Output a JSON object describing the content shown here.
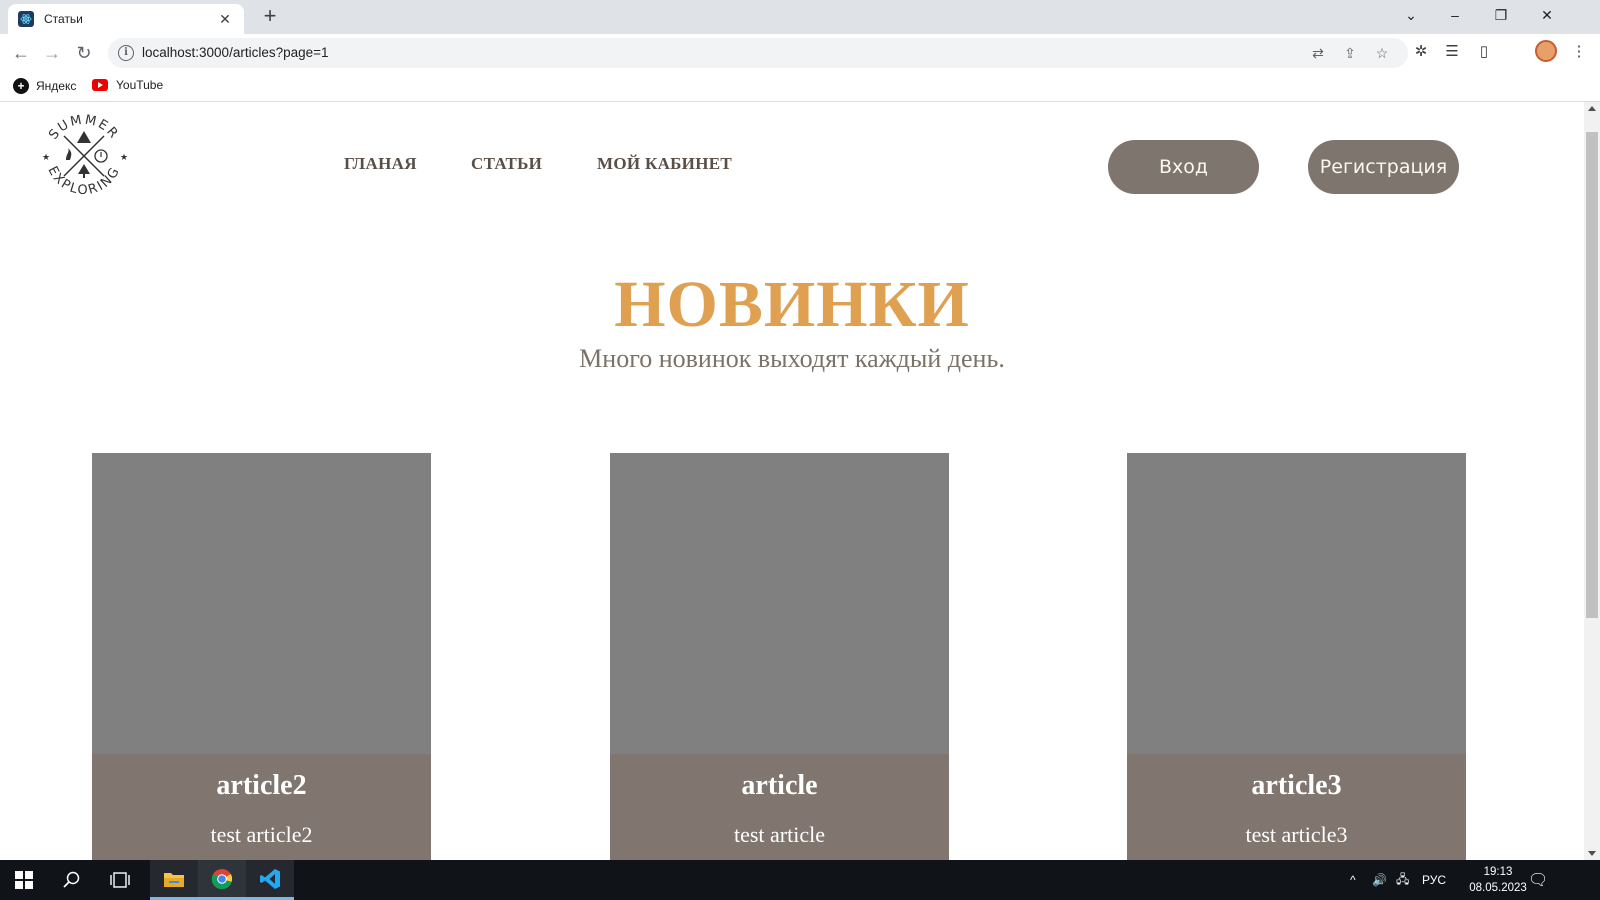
{
  "browser": {
    "tab": {
      "title": "Статьи",
      "close_glyph": "✕",
      "favicon": "react-icon"
    },
    "newtab_glyph": "+",
    "window_controls": {
      "tabsearch": "⌄",
      "minimize": "–",
      "restore": "❐",
      "close": "✕"
    },
    "address": {
      "url": "localhost:3000/articles?page=1",
      "info_glyph": "i"
    },
    "nav": {
      "back": "←",
      "forward": "→",
      "reload": "↻"
    },
    "omnibox_icons": {
      "translate": "⇄",
      "share": "⇪",
      "star": "☆"
    },
    "extensions": {
      "puzzle": "✲",
      "reading_list": "☰",
      "side_panel": "▯",
      "menu": "⋮"
    },
    "bookmarks": [
      {
        "label": "Яндекс",
        "icon": "yandex-icon",
        "glyph": "+"
      },
      {
        "label": "YouTube",
        "icon": "youtube-icon"
      }
    ]
  },
  "site": {
    "logo_alt": "SUMMER EXPLORING",
    "logo": {
      "top": "SUMMER",
      "bottom": "EXPLORING"
    },
    "nav": [
      "ГЛАНАЯ",
      "СТАТЬИ",
      "МОЙ КАБИНЕТ"
    ],
    "buttons": {
      "login": "Вход",
      "register": "Регистрация"
    },
    "hero": {
      "title": "НОВИНКИ",
      "subtitle": "Много новинок выходят каждый день."
    },
    "articles": [
      {
        "title": "article2",
        "description": "test article2"
      },
      {
        "title": "article",
        "description": "test article"
      },
      {
        "title": "article3",
        "description": "test article3"
      }
    ],
    "colors": {
      "accent": "#dfa052",
      "button_bg": "#7e756e",
      "card_image": "#808080",
      "card_body": "#80766f",
      "nav_text": "#5a4f47"
    }
  },
  "taskbar": {
    "start": "⊞",
    "search": "⌕",
    "taskview": "❏",
    "apps": [
      "file-explorer",
      "chrome",
      "vscode"
    ],
    "tray": {
      "chevron": "^",
      "volume": "🔊",
      "network": "🖧",
      "language": "РУС",
      "notifications": "🗨"
    },
    "clock": {
      "time": "19:13",
      "date": "08.05.2023"
    }
  }
}
